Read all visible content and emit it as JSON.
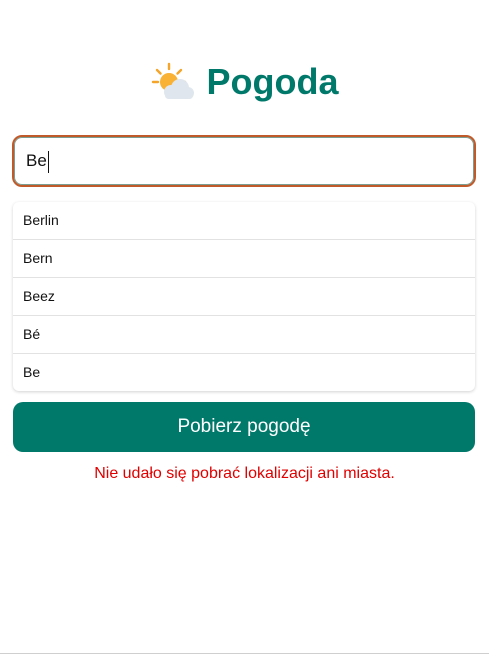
{
  "header": {
    "title": "Pogoda",
    "icon": "sun-behind-cloud-icon"
  },
  "search": {
    "value": "Be",
    "placeholder": ""
  },
  "suggestions": [
    {
      "label": "Berlin"
    },
    {
      "label": "Bern"
    },
    {
      "label": "Beez"
    },
    {
      "label": "Bé"
    },
    {
      "label": "Be"
    }
  ],
  "button": {
    "label": "Pobierz pogodę"
  },
  "error": {
    "message": "Nie udało się pobrać lokalizacji ani miasta."
  },
  "colors": {
    "accent": "#00796b",
    "error": "#e00000",
    "focus_border": "#c05a2a"
  }
}
